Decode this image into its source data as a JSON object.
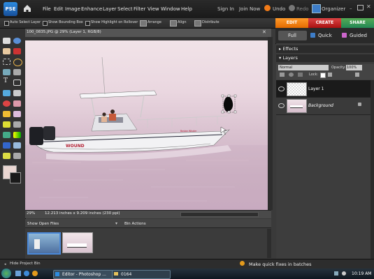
{
  "app": {
    "logo_text": "PSE",
    "menu": [
      "File",
      "Edit",
      "Image",
      "Enhance",
      "Layer",
      "Select",
      "Filter",
      "View",
      "Window",
      "Help"
    ],
    "sign_in": "Sign In",
    "join_now": "Join Now",
    "undo": "Undo",
    "redo": "Redo",
    "organizer": "Organizer"
  },
  "options_bar": {
    "auto_select": "Auto Select Layer",
    "bounding_box": "Show Bounding Box",
    "highlight_rollover": "Show Highlight on Rollover",
    "arrange": "Arrange",
    "align": "Align",
    "distribute": "Distribute"
  },
  "mode_tabs": {
    "edit": "EDIT",
    "create": "CREATE",
    "share": "SHARE"
  },
  "edit_tabs": {
    "full": "Full",
    "quick": "Quick",
    "guided": "Guided"
  },
  "document": {
    "title": "100_0835.JPG @ 29% (Layer 1, RGB/8)",
    "zoom": "29%",
    "size": "12.213 inches x 9.209 inches (230 ppi)",
    "boat_text_1": "WOUND",
    "boat_text_2": "Boston Whaler"
  },
  "project_bin": {
    "show_open_files": "Show Open Files",
    "bin_actions": "Bin Actions",
    "hide": "Hide Project Bin"
  },
  "panels": {
    "effects": "Effects",
    "layers": "Layers",
    "blend_mode": "Normal",
    "opacity_label": "Opacity:",
    "opacity_value": "100%",
    "lock_label": "Lock:",
    "layers_list": [
      {
        "name": "Layer 1",
        "selected": true
      },
      {
        "name": "Background",
        "selected": false
      }
    ]
  },
  "hint": "Make quick fixes in batches",
  "taskbar": {
    "editor": "Editor - Photoshop ...",
    "folder": "0164",
    "clock": "10:19 AM"
  },
  "colors": {
    "edit": "#f28a1d",
    "create": "#c62b2b",
    "share": "#3a8e3a",
    "accent": "#3d7dc8"
  }
}
